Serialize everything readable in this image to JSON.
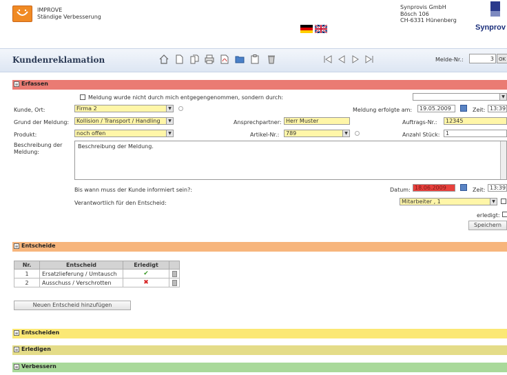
{
  "header": {
    "app_name": "IMPROVE",
    "app_subtitle": "Ständige Verbesserung",
    "company_lines": [
      "Synprovis GmbH",
      "Bösch 106",
      "CH-6331 Hünenberg"
    ],
    "brand": "Synprov"
  },
  "titlebar": {
    "title": "Kundenreklamation",
    "toolbar_icons": [
      "home-icon",
      "new-document-icon",
      "copy-document-icon",
      "print-icon",
      "pdf-icon",
      "folder-icon",
      "clipboard-icon",
      "trash-icon",
      "first-icon",
      "previous-icon",
      "next-icon",
      "last-icon"
    ],
    "melde_label": "Melde-Nr.:",
    "melde_value": "3",
    "ok_label": "OK"
  },
  "sections": {
    "erfassen": "Erfassen",
    "entscheide": "Entscheide",
    "entscheiden": "Entscheiden",
    "erledigen": "Erledigen",
    "verbessern": "Verbessern",
    "toggle_symbol": "≡"
  },
  "form": {
    "not_received_label": "Meldung wurde nicht durch mich entgegengenommen, sondern durch:",
    "kunde_label": "Kunde, Ort:",
    "kunde_value": "Firma 2",
    "meldung_am_label": "Meldung erfolgte am:",
    "meldung_am_value": "19.05.2009",
    "zeit_label": "Zeit:",
    "zeit_value": "13:39",
    "grund_label": "Grund der Meldung:",
    "grund_value": "Kollision / Transport / Handling",
    "ansprech_label": "Ansprechpartner:",
    "ansprech_value": "Herr Muster",
    "auftrag_label": "Auftrags-Nr.:",
    "auftrag_value": "12345",
    "produkt_label": "Produkt:",
    "produkt_value": "noch offen",
    "artikel_label": "Artikel-Nr.:",
    "artikel_value": "789",
    "anzahl_label": "Anzahl Stück:",
    "anzahl_value": "1",
    "beschreibung_label_1": "Beschreibung der",
    "beschreibung_label_2": "Meldung:",
    "beschreibung_value": "Beschreibung der Meldung.",
    "bis_wann_label": "Bis wann muss der Kunde informiert sein?:",
    "datum_label": "Datum:",
    "datum_value": "18.06.2009",
    "zeit2_value": "13:39",
    "verantwortlich_label": "Verantwortlich für den Entscheid:",
    "verantwortlich_value": "Mitarbeiter , 1",
    "erledigt_label": "erledigt:",
    "speichern_label": "Speichern"
  },
  "table": {
    "headers": [
      "Nr.",
      "Entscheid",
      "Erledigt",
      ""
    ],
    "rows": [
      {
        "nr": "1",
        "entscheid": "Ersatzlieferung / Umtausch",
        "erledigt": "✔"
      },
      {
        "nr": "2",
        "entscheid": "Ausschuss / Verschrotten",
        "erledigt": "✖"
      }
    ],
    "add_button": "Neuen Entscheid hinzufügen"
  },
  "colors": {
    "erfassen": "#ea7b73",
    "entscheide": "#f7b57c",
    "entscheiden": "#fbe874",
    "erledigen": "#e4dc88",
    "verbessern": "#a9d99a"
  }
}
